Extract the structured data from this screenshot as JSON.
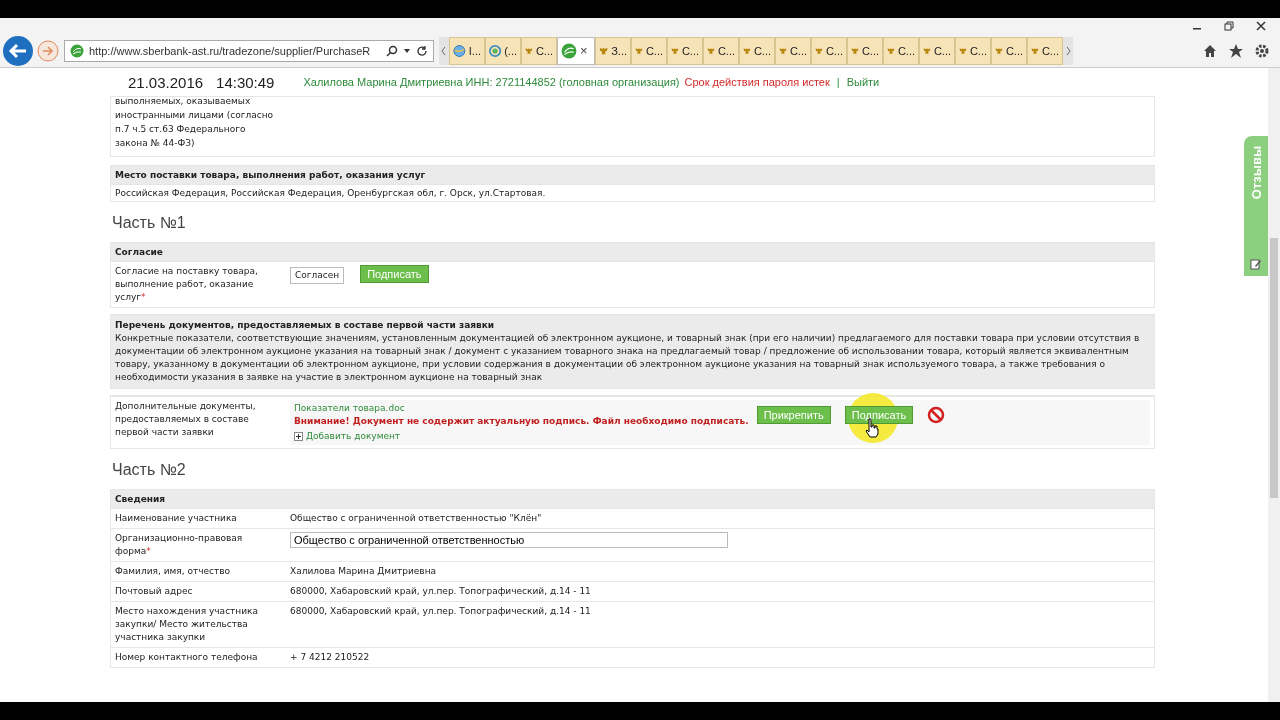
{
  "browser": {
    "url": "http://www.sberbank-ast.ru/tradezone/supplier/PurchaseR",
    "tabs": [
      {
        "label": "I...",
        "kind": "globe",
        "selected": false
      },
      {
        "label": "(...",
        "kind": "ring",
        "selected": false
      },
      {
        "label": "С...",
        "kind": "crest",
        "selected": false
      },
      {
        "kind": "leaf",
        "selected": true,
        "close": "×"
      },
      {
        "label": "З...",
        "kind": "crest",
        "selected": false
      },
      {
        "label": "С...",
        "kind": "crest",
        "selected": false
      },
      {
        "label": "С...",
        "kind": "crest",
        "selected": false
      },
      {
        "label": "С...",
        "kind": "crest",
        "selected": false
      },
      {
        "label": "С...",
        "kind": "crest",
        "selected": false
      },
      {
        "label": "С...",
        "kind": "crest",
        "selected": false
      },
      {
        "label": "С...",
        "kind": "crest",
        "selected": false
      },
      {
        "label": "С...",
        "kind": "crest",
        "selected": false
      },
      {
        "label": "С...",
        "kind": "crest",
        "selected": false
      },
      {
        "label": "С...",
        "kind": "crest",
        "selected": false
      },
      {
        "label": "С...",
        "kind": "crest",
        "selected": false
      },
      {
        "label": "С...",
        "kind": "crest",
        "selected": false
      },
      {
        "label": "С...",
        "kind": "crest",
        "selected": false
      }
    ]
  },
  "header": {
    "date": "21.03.2016",
    "time": "14:30:49",
    "user": "Халилова Марина Дмитриевна ИНН: 2721144852 (головная организация)",
    "warning": "Срок действия пароля истек",
    "separator": "|",
    "logout": "Выйти"
  },
  "top_fragment": "выполняемых, оказываемых иностранными лицами (согласно п.7 ч.5 ст.63 Федерального закона № 44-ФЗ)",
  "delivery": {
    "heading": "Место поставки товара, выполнения работ, оказания услуг",
    "value": "Российская Федерация, Российская Федерация, Оренбургская обл, г. Орск, ул.Стартовая."
  },
  "part1": {
    "title": "Часть №1",
    "consent": {
      "heading": "Согласие",
      "label": "Согласие на поставку товара, выполнение работ, оказание услуг",
      "mark": "*",
      "value": "Согласен",
      "button": "Подписать"
    },
    "documents": {
      "heading": "Перечень документов, предоставляемых в составе первой части заявки",
      "description": "Конкретные показатели, соответствующие значениям, установленным документацией об электронном аукционе, и товарный знак (при его наличии) предлагаемого для поставки товара при условии отсутствия в документации об электронном аукционе указания на товарный знак / документ с указанием товарного знака на предлагаемый товар / предложение об использовании товара, который является эквивалентным товару, указанному в документации об электронном аукционе, при условии содержания в документации об электронном аукционе указания на товарный знак используемого товара, а также требования о необходимости указания в заявке на участие в электронном аукционе на товарный знак",
      "label": "Дополнительные документы, предоставляемых в составе первой части заявки",
      "file": "Показатели товара.doc",
      "warning": "Внимание! Документ не содержит актуальную подпись. Файл необходимо подписать.",
      "attach": "Прикрепить",
      "sign": "Подписать",
      "add": "Добавить документ"
    }
  },
  "part2": {
    "title": "Часть №2",
    "heading": "Сведения",
    "rows": [
      {
        "kind": "text",
        "label": "Наименование участника",
        "value": "Общество с ограниченной ответственностью \"Клён\""
      },
      {
        "kind": "input",
        "label": "Организационно-правовая форма",
        "mark": "*",
        "value": "Общество с ограниченной ответственностью"
      },
      {
        "kind": "text",
        "label": "Фамилия, имя, отчество",
        "value": "Халилова Марина Дмитриевна"
      },
      {
        "kind": "text",
        "label": "Почтовый адрес",
        "value": "680000, Хабаровский край, ул.пер. Топографический, д.14 - 11"
      },
      {
        "kind": "text",
        "label": "Место нахождения участника закупки/ Место жительства участника закупки",
        "value": "680000, Хабаровский край, ул.пер. Топографический, д.14 - 11"
      },
      {
        "kind": "text",
        "label": "Номер контактного телефона",
        "value": "+ 7 4212 210522"
      }
    ]
  },
  "feedback": "Отзывы"
}
